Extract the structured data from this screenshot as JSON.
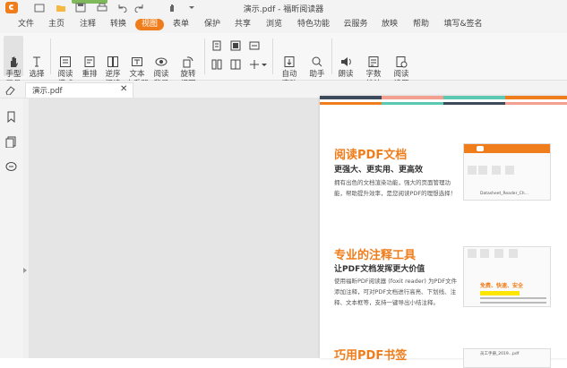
{
  "window": {
    "title": "演示.pdf - 福昕阅读器"
  },
  "menu": [
    {
      "label": "文件"
    },
    {
      "label": "主页"
    },
    {
      "label": "注释"
    },
    {
      "label": "转换"
    },
    {
      "label": "视图",
      "active": true
    },
    {
      "label": "表单"
    },
    {
      "label": "保护"
    },
    {
      "label": "共享"
    },
    {
      "label": "浏览"
    },
    {
      "label": "特色功能"
    },
    {
      "label": "云服务"
    },
    {
      "label": "放映"
    },
    {
      "label": "帮助"
    },
    {
      "label": "填写&签名"
    }
  ],
  "ribbon": {
    "hand": "手型\n工具",
    "select": "选择",
    "read_mode": "阅读\n模式",
    "reflow": "重排",
    "reverse_read": "逆序\n阅读",
    "text_viewer": "文本\n查看器",
    "read_bg": "阅读\n背景",
    "rotate": "旋转\n视图",
    "autoscroll": "自动\n滚动",
    "assistant": "助手",
    "read_aloud": "朗读",
    "word_count": "字数\n统计",
    "page_settings": "阅读\n设置"
  },
  "tab": {
    "label": "演示.pdf"
  },
  "page": {
    "colors": {
      "orange": "#f07d1b",
      "teal": "#5bc9b2",
      "slate": "#3c4a5c",
      "salmon": "#f4a090"
    },
    "sec1": {
      "title": "阅读PDF文档",
      "sub": "更强大、更实用、更高效",
      "body": "拥有出色的文档渲染功能，强大的页面管理功能，帮助提升效率，是您阅读PDF的理想选择！"
    },
    "sec2": {
      "title": "专业的注释工具",
      "sub": "让PDF文档发挥更大价值",
      "body": "使用福昕PDF阅读器 (foxit reader) 为PDF文件添加注释，可对PDF文档进行高亮、下划线、注释、文本框等，支持一键导出小结注释。"
    },
    "sec3": {
      "title": "巧用PDF书签"
    },
    "thumb1": {
      "tab": "Datasheet_Reader_Ch..."
    },
    "thumb2": {
      "orange": "免费、快速、安全"
    },
    "thumb3": {
      "tab": "员工手册_2019...pdf"
    }
  }
}
